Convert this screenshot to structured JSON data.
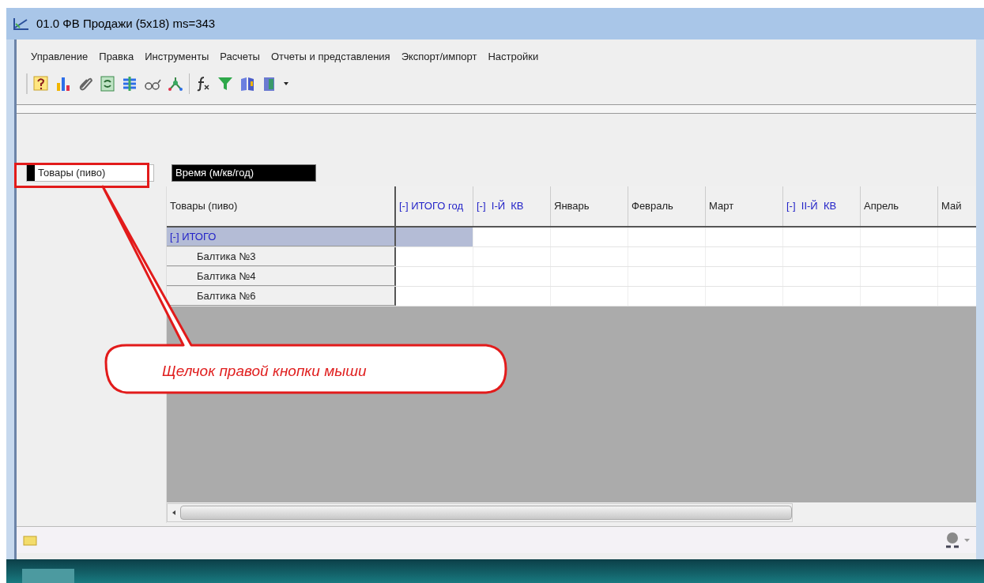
{
  "window": {
    "title": "01.0  ФВ  Продажи (5x18) ms=343"
  },
  "menu": [
    "Управление",
    "Правка",
    "Инструменты",
    "Расчеты",
    "Отчеты и представления",
    "Экспорт/импорт",
    "Настройки"
  ],
  "filters": {
    "rows_dimension": "Товары (пиво)",
    "columns_dimension": "Время (м/кв/год)"
  },
  "table": {
    "corner": "Товары (пиво)",
    "columns": [
      {
        "label": "[-] ИТОГО год",
        "kind": "group"
      },
      {
        "label": "[-]  I-Й  КВ",
        "kind": "group"
      },
      {
        "label": "Январь",
        "kind": "member"
      },
      {
        "label": "Февраль",
        "kind": "member"
      },
      {
        "label": "Март",
        "kind": "member"
      },
      {
        "label": "[-]  II-Й  КВ",
        "kind": "group"
      },
      {
        "label": "Апрель",
        "kind": "member"
      },
      {
        "label": "Май",
        "kind": "member"
      }
    ],
    "rows": [
      {
        "label": "[-] ИТОГО",
        "selected": true,
        "children": [
          {
            "label": "Балтика №3",
            "selected": false
          },
          {
            "label": "Балтика №4",
            "selected": false
          },
          {
            "label": "Балтика №6",
            "selected": false
          }
        ]
      }
    ]
  },
  "callout": {
    "text": "Щелчок правой кнопки   мыши"
  }
}
